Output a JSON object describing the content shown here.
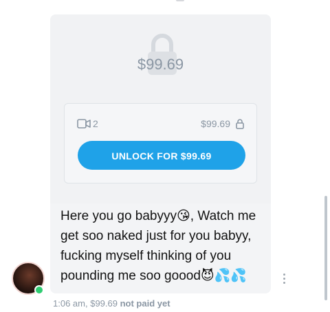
{
  "post": {
    "preview_price": "$99.69",
    "media_count": "2",
    "card_price": "$99.69",
    "unlock_label": "UNLOCK FOR $99.69",
    "message_lines": [
      "Here you go babyyy😘, Watch me",
      "get soo naked just for you babyy,",
      "fucking myself thinking of you",
      "pounding me soo goood😈💦💦"
    ]
  },
  "meta": {
    "time": "1:06 am,",
    "price": "$99.69",
    "status": "not paid yet"
  },
  "icons": {
    "lock": "lock-icon",
    "video": "video-camera-icon",
    "more": "more-vertical-icon"
  },
  "colors": {
    "accent": "#1fa2e8",
    "muted": "#8a96a3",
    "online": "#2ecc71"
  }
}
